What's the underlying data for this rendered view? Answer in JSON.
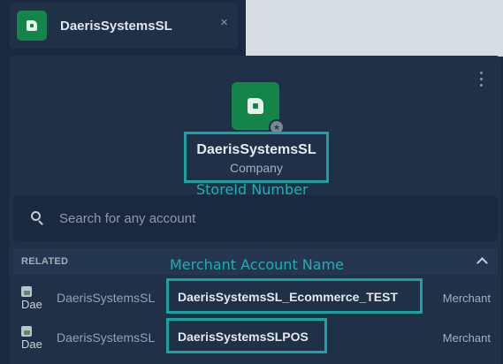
{
  "tab": {
    "title": "DaerisSystemsSL",
    "close_label": "×"
  },
  "profile": {
    "name": "DaerisSystemsSL",
    "type": "Company"
  },
  "annotations": {
    "store_id": "StoreId Number",
    "merchant_account": "Merchant Account Name"
  },
  "search": {
    "placeholder": "Search for any account"
  },
  "related": {
    "header": "RELATED",
    "items": [
      {
        "thumb_text": "Dae",
        "store": "DaerisSystemsSL",
        "account": "DaerisSystemsSL_Ecommerce_TEST",
        "type": "Merchant"
      },
      {
        "thumb_text": "Dae",
        "store": "DaerisSystemsSL",
        "account": "DaerisSystemsSLPOS",
        "type": "Merchant"
      }
    ]
  },
  "colors": {
    "brand_green": "#14854a",
    "highlight_teal": "#1aa3a3",
    "panel_bg": "#1f3047"
  },
  "icons": {
    "logo": "company-logo-icon",
    "close": "close-icon",
    "more": "more-vertical-icon",
    "search": "search-icon",
    "collapse": "chevron-up-icon",
    "badge": "star-badge-icon"
  }
}
